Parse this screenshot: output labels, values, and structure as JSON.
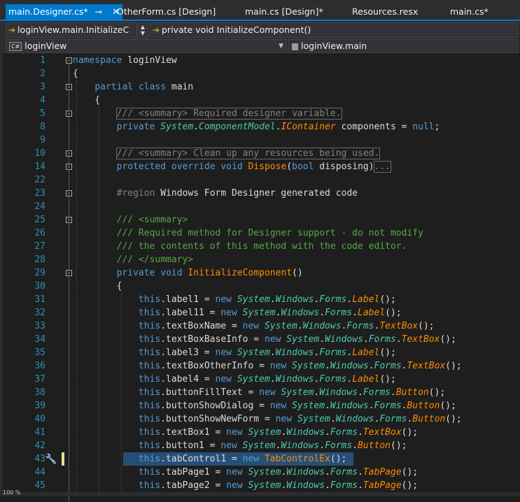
{
  "tabs": [
    {
      "label": "main.Designer.cs*",
      "active": true
    },
    {
      "label": "OtherForm.cs [Design]",
      "active": false
    },
    {
      "label": "main.cs [Design]*",
      "active": false
    },
    {
      "label": "Resources.resx",
      "active": false
    },
    {
      "label": "main.cs*",
      "active": false
    }
  ],
  "tab_icons": {
    "pin": "⊸",
    "close": "✕"
  },
  "nav": {
    "project_combo": "loginView.main.InitializeC",
    "member_combo": "private void InitializeComponent()",
    "class_combo": "loginView",
    "type_combo": "loginView.main",
    "lang_icon": "C#"
  },
  "code_lines": [
    {
      "n": "1",
      "fold": "-",
      "html": "<span class='kw'>namespace</span> loginView"
    },
    {
      "n": "2",
      "fold": "",
      "html": "{"
    },
    {
      "n": "3",
      "fold": "-",
      "html": "    <span class='kw'>partial</span> <span class='kw'>class</span> main"
    },
    {
      "n": "4",
      "fold": "",
      "html": "    {"
    },
    {
      "n": "5",
      "fold": "+",
      "html": "        <span class='cmg boxed'>/// &lt;summary&gt; Required designer variable.</span>"
    },
    {
      "n": "8",
      "fold": "",
      "html": "        <span class='kw'>private</span> <span class='ty it'>System</span>.<span class='ty it'>ComponentModel</span>.<span class='mt it'>IContainer</span> <span class='plain'>components</span> = <span class='kw'>null</span>;"
    },
    {
      "n": "9",
      "fold": "",
      "html": ""
    },
    {
      "n": "10",
      "fold": "+",
      "html": "        <span class='cmg boxed'>/// &lt;summary&gt; Clean up any resources being used.</span>"
    },
    {
      "n": "14",
      "fold": "+",
      "html": "        <span class='kw'>protected</span> <span class='kw'>override</span> <span class='kw'>void</span> <span class='mt'>Dispose</span>(<span class='kw'>bool</span> disposing)<span class='cmg boxed'>...</span>"
    },
    {
      "n": "22",
      "fold": "",
      "html": ""
    },
    {
      "n": "23",
      "fold": "-",
      "html": "        <span class='cmg'>#region</span> Windows Form Designer generated code"
    },
    {
      "n": "24",
      "fold": "",
      "html": ""
    },
    {
      "n": "25",
      "fold": "-",
      "html": "        <span class='cm'>/// &lt;summary&gt;</span>"
    },
    {
      "n": "26",
      "fold": "",
      "html": "        <span class='cm'>/// Required method for Designer support - do not modify</span>"
    },
    {
      "n": "27",
      "fold": "",
      "html": "        <span class='cm'>/// the contents of this method with the code editor.</span>"
    },
    {
      "n": "28",
      "fold": "",
      "html": "        <span class='cm'>/// &lt;/summary&gt;</span>"
    },
    {
      "n": "29",
      "fold": "-",
      "html": "        <span class='kw'>private</span> <span class='kw'>void</span> <span class='mt'>InitializeComponent</span>()"
    },
    {
      "n": "30",
      "fold": "",
      "html": "        {"
    },
    {
      "n": "31",
      "fold": "",
      "html": "            <span class='kw'>this</span>.label1 = <span class='kw'>new</span> <span class='ty it'>System</span>.<span class='ty it'>Windows</span>.<span class='ty it'>Forms</span>.<span class='mt it'>Label</span>();"
    },
    {
      "n": "32",
      "fold": "",
      "html": "            <span class='kw'>this</span>.label11 = <span class='kw'>new</span> <span class='ty it'>System</span>.<span class='ty it'>Windows</span>.<span class='ty it'>Forms</span>.<span class='mt it'>Label</span>();"
    },
    {
      "n": "33",
      "fold": "",
      "html": "            <span class='kw'>this</span>.textBoxName = <span class='kw'>new</span> <span class='ty it'>System</span>.<span class='ty it'>Windows</span>.<span class='ty it'>Forms</span>.<span class='mt it'>TextBox</span>();"
    },
    {
      "n": "34",
      "fold": "",
      "html": "            <span class='kw'>this</span>.textBoxBaseInfo = <span class='kw'>new</span> <span class='ty it'>System</span>.<span class='ty it'>Windows</span>.<span class='ty it'>Forms</span>.<span class='mt it'>TextBox</span>();"
    },
    {
      "n": "35",
      "fold": "",
      "html": "            <span class='kw'>this</span>.label3 = <span class='kw'>new</span> <span class='ty it'>System</span>.<span class='ty it'>Windows</span>.<span class='ty it'>Forms</span>.<span class='mt it'>Label</span>();"
    },
    {
      "n": "36",
      "fold": "",
      "html": "            <span class='kw'>this</span>.textBoxOtherInfo = <span class='kw'>new</span> <span class='ty it'>System</span>.<span class='ty it'>Windows</span>.<span class='ty it'>Forms</span>.<span class='mt it'>TextBox</span>();"
    },
    {
      "n": "37",
      "fold": "",
      "html": "            <span class='kw'>this</span>.label4 = <span class='kw'>new</span> <span class='ty it'>System</span>.<span class='ty it'>Windows</span>.<span class='ty it'>Forms</span>.<span class='mt it'>Label</span>();"
    },
    {
      "n": "38",
      "fold": "",
      "html": "            <span class='kw'>this</span>.buttonFillText = <span class='kw'>new</span> <span class='ty it'>System</span>.<span class='ty it'>Windows</span>.<span class='ty it'>Forms</span>.<span class='mt it'>Button</span>();"
    },
    {
      "n": "39",
      "fold": "",
      "html": "            <span class='kw'>this</span>.buttonShowDialog = <span class='kw'>new</span> <span class='ty it'>System</span>.<span class='ty it'>Windows</span>.<span class='ty it'>Forms</span>.<span class='mt it'>Button</span>();"
    },
    {
      "n": "40",
      "fold": "",
      "html": "            <span class='kw'>this</span>.buttonShowNewForm = <span class='kw'>new</span> <span class='ty it'>System</span>.<span class='ty it'>Windows</span>.<span class='ty it'>Forms</span>.<span class='mt it'>Button</span>();"
    },
    {
      "n": "41",
      "fold": "",
      "html": "            <span class='kw'>this</span>.textBox1 = <span class='kw'>new</span> <span class='ty it'>System</span>.<span class='ty it'>Windows</span>.<span class='ty it'>Forms</span>.<span class='mt it'>TextBox</span>();"
    },
    {
      "n": "42",
      "fold": "",
      "html": "            <span class='kw'>this</span>.button1 = <span class='kw'>new</span> <span class='ty it'>System</span>.<span class='ty it'>Windows</span>.<span class='ty it'>Forms</span>.<span class='mt it'>Button</span>();"
    },
    {
      "n": "43",
      "fold": "",
      "html": "            <span class='kw'>this</span>.tabControl1 = <span class='kw'>new</span> <span class='mt'>TabControlEx</span>();"
    },
    {
      "n": "44",
      "fold": "",
      "html": "            <span class='kw'>this</span>.tabPage1 = <span class='kw'>new</span> <span class='ty it'>System</span>.<span class='ty it'>Windows</span>.<span class='ty it'>Forms</span>.<span class='mt it'>TabPage</span>();"
    },
    {
      "n": "45",
      "fold": "",
      "html": "            <span class='kw'>this</span>.tabPage2 = <span class='kw'>new</span> <span class='ty it'>System</span>.<span class='ty it'>Windows</span>.<span class='ty it'>Forms</span>.<span class='mt it'>TabPage</span>();"
    }
  ],
  "selected_line": "43",
  "status": {
    "zoom": "100 %"
  }
}
